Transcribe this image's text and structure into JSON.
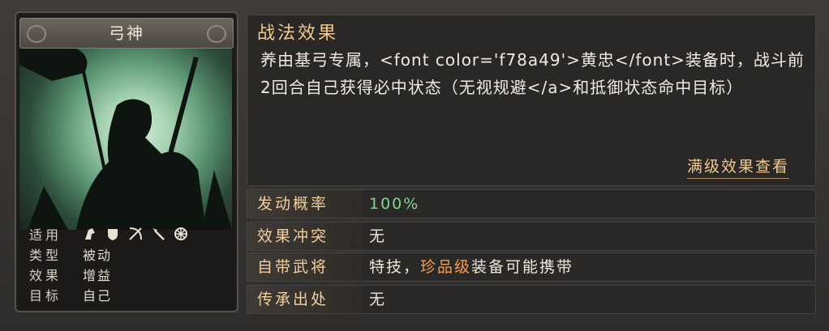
{
  "skill": {
    "name": "弓神",
    "info": [
      {
        "key": "适用",
        "value": "",
        "icons": [
          "cavalry-icon",
          "shield-icon",
          "bow-icon",
          "spear-icon",
          "siege-icon"
        ]
      },
      {
        "key": "类型",
        "value": "被动"
      },
      {
        "key": "效果",
        "value": "增益"
      },
      {
        "key": "目标",
        "value": "自己"
      }
    ]
  },
  "effect": {
    "title": "战法效果",
    "description": "养由基弓专属，<font color='f78a49'>黄忠</font>装备时，战斗前2回合自己获得必中状态（无视规避</a>和抵御状态命中目标）",
    "full_link": "满级效果查看"
  },
  "attributes": [
    {
      "key": "发动概率",
      "value": "100%"
    },
    {
      "key": "效果冲突",
      "value": "无"
    },
    {
      "key": "自带武将",
      "value_prefix": "特技，",
      "value_highlight": "珍品级",
      "value_suffix": "装备可能携带"
    },
    {
      "key": "传承出处",
      "value": "无"
    }
  ],
  "colors": {
    "accent": "#f2c98a",
    "rate": "#7cd88e",
    "highlight": "#f59b52"
  }
}
